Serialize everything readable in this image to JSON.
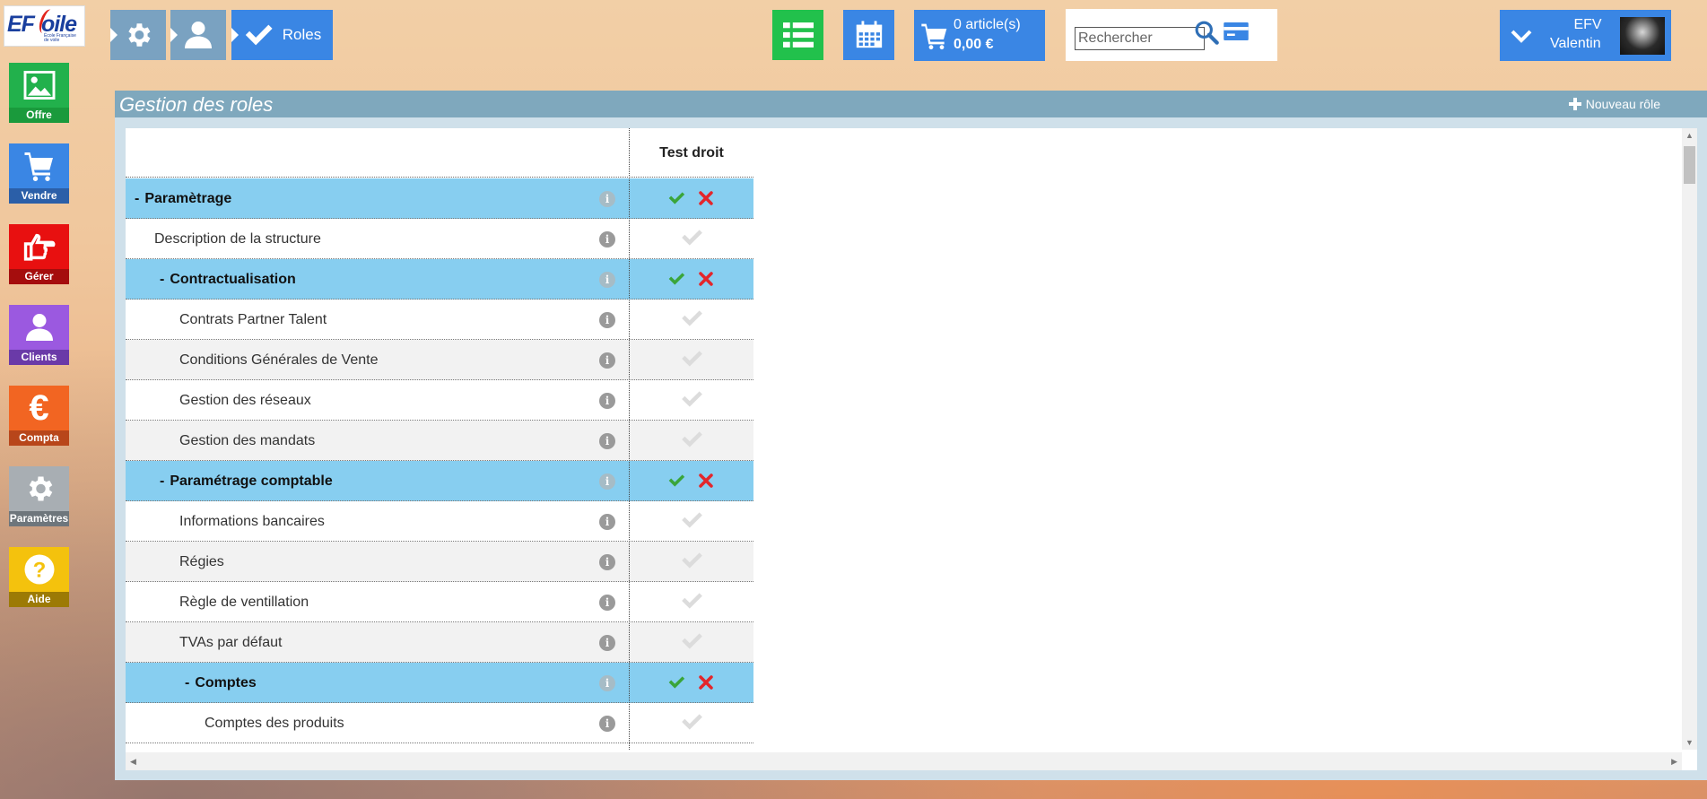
{
  "logo": {
    "text": "EF",
    "text2": "oile",
    "sub": "École Française de voile"
  },
  "breadcrumb": {
    "current": "Roles"
  },
  "cart": {
    "count": "0 article(s)",
    "total": "0,00 €"
  },
  "search": {
    "placeholder": "Rechercher"
  },
  "user": {
    "line1": "EFV",
    "line2": "Valentin"
  },
  "sidebar": {
    "items": [
      {
        "label": "Offre",
        "color": "#22b14c",
        "band": "#1a9a3c"
      },
      {
        "label": "Vendre",
        "color": "#3a86e4",
        "band": "#2b5fa8"
      },
      {
        "label": "Gérer",
        "color": "#e81010",
        "band": "#a50d0d"
      },
      {
        "label": "Clients",
        "color": "#9b59e0",
        "band": "#6a3aa8"
      },
      {
        "label": "Compta",
        "color": "#f26522",
        "band": "#b8461a"
      },
      {
        "label": "Paramètres",
        "color": "#a8aeb3",
        "band": "#6e767c"
      },
      {
        "label": "Aide",
        "color": "#f4c20d",
        "band": "#9c7a05"
      }
    ]
  },
  "panel": {
    "title": "Gestion des roles",
    "new_role": "Nouveau rôle"
  },
  "table": {
    "column": "Test droit",
    "rows": [
      {
        "label": "Paramètrage",
        "type": "group",
        "prefix": "-",
        "level": 0
      },
      {
        "label": "Description de la structure",
        "type": "item",
        "level": 1
      },
      {
        "label": "Contractualisation",
        "type": "group",
        "prefix": "-",
        "level": 1
      },
      {
        "label": "Contrats Partner Talent",
        "type": "item",
        "level": 2
      },
      {
        "label": "Conditions Générales de Vente",
        "type": "item",
        "level": 2
      },
      {
        "label": "Gestion des réseaux",
        "type": "item",
        "level": 2
      },
      {
        "label": "Gestion des mandats",
        "type": "item",
        "level": 2
      },
      {
        "label": "Paramétrage comptable",
        "type": "group",
        "prefix": "-",
        "level": 1
      },
      {
        "label": "Informations bancaires",
        "type": "item",
        "level": 2
      },
      {
        "label": "Régies",
        "type": "item",
        "level": 2
      },
      {
        "label": "Règle de ventillation",
        "type": "item",
        "level": 2
      },
      {
        "label": "TVAs par défaut",
        "type": "item",
        "level": 2
      },
      {
        "label": "Comptes",
        "type": "group",
        "prefix": "-",
        "level": 2
      },
      {
        "label": "Comptes des produits",
        "type": "item",
        "level": 3
      }
    ]
  },
  "icons": {
    "info": "info-icon",
    "check": "check-icon",
    "cross": "cross-icon"
  }
}
